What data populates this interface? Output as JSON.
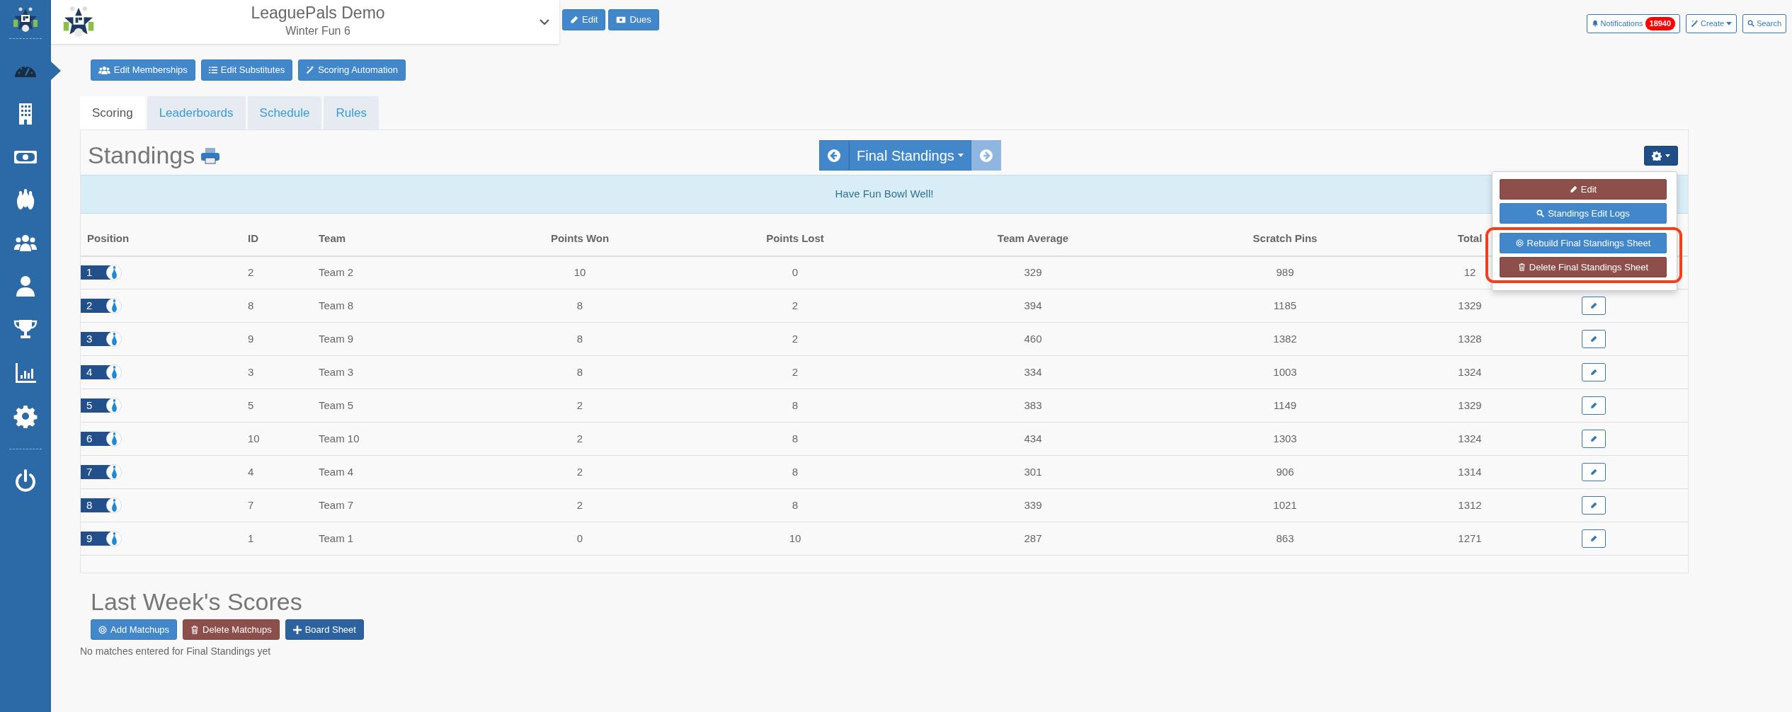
{
  "sidebar": {
    "items": [
      {
        "kind": "dashboard",
        "selected": true
      },
      {
        "kind": "building",
        "selected": false
      },
      {
        "kind": "money",
        "selected": false
      },
      {
        "kind": "pins",
        "selected": false
      },
      {
        "kind": "group",
        "selected": false
      },
      {
        "kind": "user",
        "selected": false
      },
      {
        "kind": "trophy",
        "selected": false
      },
      {
        "kind": "chart",
        "selected": false
      },
      {
        "kind": "settings",
        "selected": false
      },
      {
        "kind": "power",
        "selected": false
      }
    ]
  },
  "league": {
    "title": "LeaguePals Demo",
    "subtitle": "Winter Fun 6"
  },
  "header_buttons": [
    {
      "label": "Edit",
      "kind": "edit"
    },
    {
      "label": "Dues",
      "kind": "dues"
    }
  ],
  "top_right": {
    "notifications": {
      "label": "Notifications",
      "count": "18940"
    },
    "create": {
      "label": "Create"
    },
    "search": {
      "label": "Search"
    }
  },
  "actions": [
    {
      "label": "Edit Memberships",
      "kind": "memberships"
    },
    {
      "label": "Edit Substitutes",
      "kind": "substitutes"
    },
    {
      "label": "Scoring Automation",
      "kind": "automation"
    }
  ],
  "tabs": [
    {
      "label": "Scoring",
      "selected": true
    },
    {
      "label": "Leaderboards",
      "selected": false
    },
    {
      "label": "Schedule",
      "selected": false
    },
    {
      "label": "Rules",
      "selected": false
    }
  ],
  "standings": {
    "title": "Standings",
    "period": "Final Standings",
    "next_disabled": true,
    "message": "Have Fun Bowl Well!",
    "menu": {
      "expanded": true,
      "items": [
        {
          "label": "Edit",
          "kind": "edit",
          "highlighted": false
        },
        {
          "label": "Standings Edit Logs",
          "kind": "logs",
          "highlighted": false
        },
        {
          "label": "Rebuild Final Standings Sheet",
          "kind": "rebuild",
          "highlighted": true
        },
        {
          "label": "Delete Final Standings Sheet",
          "kind": "delete",
          "highlighted": true
        }
      ]
    }
  },
  "table": {
    "columns": [
      "Position",
      "ID",
      "Team",
      "Points Won",
      "Points Lost",
      "Team Average",
      "Scratch Pins",
      "Total"
    ],
    "rows": [
      {
        "cells": [
          "1",
          "2",
          "Team 2",
          "10",
          "0",
          "329",
          "989",
          "12"
        ],
        "edit_button": false
      },
      {
        "cells": [
          "2",
          "8",
          "Team 8",
          "8",
          "2",
          "394",
          "1185",
          "1329"
        ],
        "edit_button": true
      },
      {
        "cells": [
          "3",
          "9",
          "Team 9",
          "8",
          "2",
          "460",
          "1382",
          "1328"
        ],
        "edit_button": true
      },
      {
        "cells": [
          "4",
          "3",
          "Team 3",
          "8",
          "2",
          "334",
          "1003",
          "1324"
        ],
        "edit_button": true
      },
      {
        "cells": [
          "5",
          "5",
          "Team 5",
          "2",
          "8",
          "383",
          "1149",
          "1329"
        ],
        "edit_button": true
      },
      {
        "cells": [
          "6",
          "10",
          "Team 10",
          "2",
          "8",
          "434",
          "1303",
          "1324"
        ],
        "edit_button": true
      },
      {
        "cells": [
          "7",
          "4",
          "Team 4",
          "2",
          "8",
          "301",
          "906",
          "1314"
        ],
        "edit_button": true
      },
      {
        "cells": [
          "8",
          "7",
          "Team 7",
          "2",
          "8",
          "339",
          "1021",
          "1312"
        ],
        "edit_button": true
      },
      {
        "cells": [
          "9",
          "1",
          "Team 1",
          "0",
          "10",
          "287",
          "863",
          "1271"
        ],
        "edit_button": true
      }
    ]
  },
  "last_week": {
    "title": "Last Week's Scores",
    "buttons": [
      {
        "label": "Add Matchups",
        "kind": "add"
      },
      {
        "label": "Delete Matchups",
        "kind": "delete"
      },
      {
        "label": "Board Sheet",
        "kind": "board"
      }
    ],
    "empty_message": "No matches entered for Final Standings yet"
  }
}
